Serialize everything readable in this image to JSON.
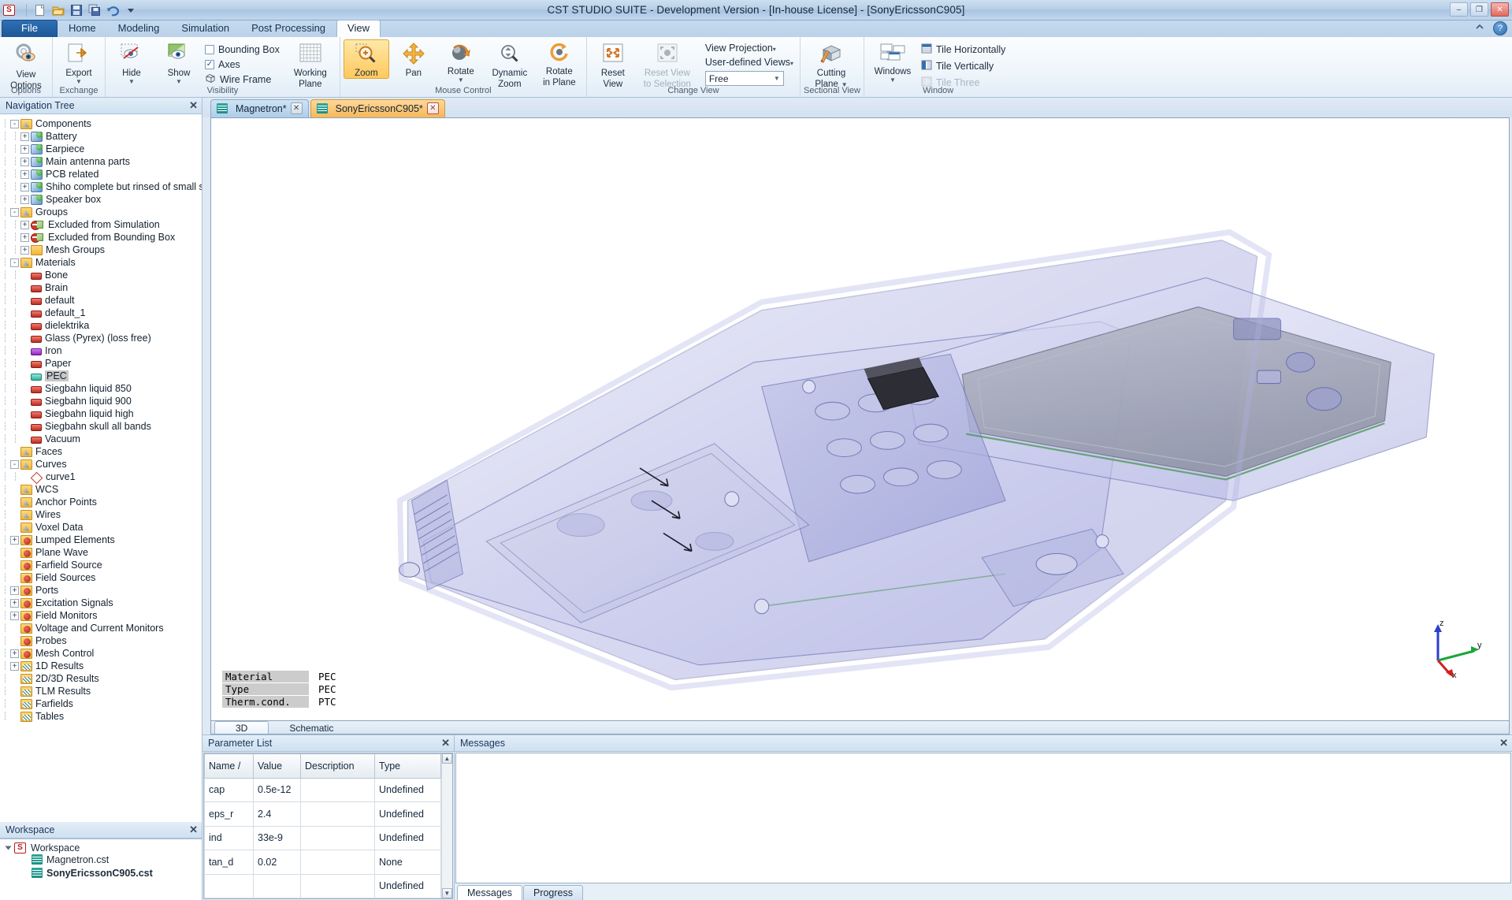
{
  "window": {
    "title": "CST STUDIO SUITE - Development Version - [In-house License] - [SonyEricssonC905]",
    "minimize": "–",
    "maximize": "❐",
    "close": "✕",
    "help": "?"
  },
  "quick_access": [
    "new-icon",
    "open-icon",
    "save-icon",
    "save-copy-icon",
    "undo-icon",
    "qat-more-icon"
  ],
  "ribbon_tabs": [
    {
      "label": "File",
      "kind": "file"
    },
    {
      "label": "Home",
      "kind": "normal"
    },
    {
      "label": "Modeling",
      "kind": "normal"
    },
    {
      "label": "Simulation",
      "kind": "normal"
    },
    {
      "label": "Post Processing",
      "kind": "normal"
    },
    {
      "label": "View",
      "kind": "active"
    }
  ],
  "ribbon": {
    "groups": [
      {
        "name": "Options",
        "label": "Options",
        "buttons": [
          {
            "label1": "View",
            "label2": "Options",
            "icon": "view-options-icon",
            "caret": false
          }
        ]
      },
      {
        "name": "Exchange",
        "label": "Exchange",
        "buttons": [
          {
            "label1": "Export",
            "label2": "",
            "icon": "export-icon",
            "caret": true
          }
        ]
      },
      {
        "name": "Visibility",
        "label": "Visibility",
        "buttons": [
          {
            "label1": "Hide",
            "label2": "",
            "icon": "hide-icon",
            "caret": true
          },
          {
            "label1": "Show",
            "label2": "",
            "icon": "show-icon",
            "caret": true
          }
        ],
        "checks": [
          {
            "label": "Bounding Box",
            "checked": false
          },
          {
            "label": "Axes",
            "checked": true
          },
          {
            "label": "Wire Frame",
            "checked": false,
            "icon": "wireframe-icon"
          }
        ],
        "extra": [
          {
            "label1": "Working",
            "label2": "Plane",
            "icon": "working-plane-icon",
            "caret": true
          }
        ]
      },
      {
        "name": "Mouse Control",
        "label": "Mouse Control",
        "buttons": [
          {
            "label1": "Zoom",
            "label2": "",
            "icon": "zoom-icon",
            "selected": true
          },
          {
            "label1": "Pan",
            "label2": "",
            "icon": "pan-icon"
          },
          {
            "label1": "Rotate",
            "label2": "",
            "icon": "rotate-icon",
            "caret": true
          },
          {
            "label1": "Dynamic",
            "label2": "Zoom",
            "icon": "dynamic-zoom-icon"
          },
          {
            "label1": "Rotate",
            "label2": "in Plane",
            "icon": "rotate-in-plane-icon"
          }
        ]
      },
      {
        "name": "Change View",
        "label": "Change View",
        "buttons": [
          {
            "label1": "Reset",
            "label2": "View",
            "icon": "reset-view-icon"
          },
          {
            "label1": "Reset View",
            "label2": "to Selection",
            "icon": "reset-view-selection-icon",
            "disabled": true
          }
        ],
        "menus": [
          "View Projection",
          "User-defined Views"
        ],
        "combo_value": "Free"
      },
      {
        "name": "Sectional View",
        "label": "Sectional View",
        "buttons": [
          {
            "label1": "Cutting",
            "label2": "Plane",
            "icon": "cutting-plane-icon",
            "caret": true
          }
        ]
      },
      {
        "name": "Window",
        "label": "Window",
        "buttons": [
          {
            "label1": "Windows",
            "label2": "",
            "icon": "windows-icon",
            "caret": true
          }
        ],
        "tiles": [
          {
            "label": "Tile Horizontally",
            "icon": "tile-horizontally-icon",
            "disabled": false
          },
          {
            "label": "Tile Vertically",
            "icon": "tile-vertically-icon",
            "disabled": false
          },
          {
            "label": "Tile Three",
            "icon": "tile-three-icon",
            "disabled": true
          }
        ]
      }
    ]
  },
  "navigation": {
    "title": "Navigation Tree",
    "close": "✕",
    "items": [
      {
        "label": "Components",
        "depth": 0,
        "expander": "-",
        "icon": "folder-warn"
      },
      {
        "label": "Battery",
        "depth": 1,
        "expander": "+",
        "icon": "component"
      },
      {
        "label": "Earpiece",
        "depth": 1,
        "expander": "+",
        "icon": "component"
      },
      {
        "label": "Main antenna parts",
        "depth": 1,
        "expander": "+",
        "icon": "component"
      },
      {
        "label": "PCB related",
        "depth": 1,
        "expander": "+",
        "icon": "component"
      },
      {
        "label": "Shiho complete but rinsed of small stuff",
        "depth": 1,
        "expander": "+",
        "icon": "component"
      },
      {
        "label": "Speaker box",
        "depth": 1,
        "expander": "+",
        "icon": "component"
      },
      {
        "label": "Groups",
        "depth": 0,
        "expander": "-",
        "icon": "folder-warn"
      },
      {
        "label": "Excluded from Simulation",
        "depth": 1,
        "expander": "+",
        "icon": "excluded"
      },
      {
        "label": "Excluded from Bounding Box",
        "depth": 1,
        "expander": "+",
        "icon": "excluded"
      },
      {
        "label": "Mesh Groups",
        "depth": 1,
        "expander": "+",
        "icon": "folder-plain"
      },
      {
        "label": "Materials",
        "depth": 0,
        "expander": "-",
        "icon": "folder-warn"
      },
      {
        "label": "Bone",
        "depth": 1,
        "expander": "",
        "icon": "material-red"
      },
      {
        "label": "Brain",
        "depth": 1,
        "expander": "",
        "icon": "material-red"
      },
      {
        "label": "default",
        "depth": 1,
        "expander": "",
        "icon": "material-red"
      },
      {
        "label": "default_1",
        "depth": 1,
        "expander": "",
        "icon": "material-red"
      },
      {
        "label": "dielektrika",
        "depth": 1,
        "expander": "",
        "icon": "material-red"
      },
      {
        "label": "Glass (Pyrex) (loss free)",
        "depth": 1,
        "expander": "",
        "icon": "material-red"
      },
      {
        "label": "Iron",
        "depth": 1,
        "expander": "",
        "icon": "material-purple"
      },
      {
        "label": "Paper",
        "depth": 1,
        "expander": "",
        "icon": "material-red"
      },
      {
        "label": "PEC",
        "depth": 1,
        "expander": "",
        "icon": "material-teal",
        "selected": true
      },
      {
        "label": "Siegbahn liquid 850",
        "depth": 1,
        "expander": "",
        "icon": "material-red"
      },
      {
        "label": "Siegbahn liquid 900",
        "depth": 1,
        "expander": "",
        "icon": "material-red"
      },
      {
        "label": "Siegbahn liquid high",
        "depth": 1,
        "expander": "",
        "icon": "material-red"
      },
      {
        "label": "Siegbahn skull all bands",
        "depth": 1,
        "expander": "",
        "icon": "material-red"
      },
      {
        "label": "Vacuum",
        "depth": 1,
        "expander": "",
        "icon": "material-red"
      },
      {
        "label": "Faces",
        "depth": 0,
        "expander": "",
        "icon": "folder-warn"
      },
      {
        "label": "Curves",
        "depth": 0,
        "expander": "-",
        "icon": "folder-warn"
      },
      {
        "label": "curve1",
        "depth": 1,
        "expander": "",
        "icon": "curve"
      },
      {
        "label": "WCS",
        "depth": 0,
        "expander": "",
        "icon": "folder-warn"
      },
      {
        "label": "Anchor Points",
        "depth": 0,
        "expander": "",
        "icon": "folder-warn"
      },
      {
        "label": "Wires",
        "depth": 0,
        "expander": "",
        "icon": "folder-warn"
      },
      {
        "label": "Voxel Data",
        "depth": 0,
        "expander": "",
        "icon": "folder-warn"
      },
      {
        "label": "Lumped Elements",
        "depth": 0,
        "expander": "+",
        "icon": "folder-gear"
      },
      {
        "label": "Plane Wave",
        "depth": 0,
        "expander": "",
        "icon": "folder-gear"
      },
      {
        "label": "Farfield Source",
        "depth": 0,
        "expander": "",
        "icon": "folder-gear"
      },
      {
        "label": "Field Sources",
        "depth": 0,
        "expander": "",
        "icon": "folder-gear"
      },
      {
        "label": "Ports",
        "depth": 0,
        "expander": "+",
        "icon": "folder-gear"
      },
      {
        "label": "Excitation Signals",
        "depth": 0,
        "expander": "+",
        "icon": "folder-gear"
      },
      {
        "label": "Field Monitors",
        "depth": 0,
        "expander": "+",
        "icon": "folder-gear"
      },
      {
        "label": "Voltage and Current Monitors",
        "depth": 0,
        "expander": "",
        "icon": "folder-gear"
      },
      {
        "label": "Probes",
        "depth": 0,
        "expander": "",
        "icon": "folder-gear"
      },
      {
        "label": "Mesh Control",
        "depth": 0,
        "expander": "+",
        "icon": "folder-gear"
      },
      {
        "label": "1D Results",
        "depth": 0,
        "expander": "+",
        "icon": "folder-results"
      },
      {
        "label": "2D/3D Results",
        "depth": 0,
        "expander": "",
        "icon": "folder-results"
      },
      {
        "label": "TLM Results",
        "depth": 0,
        "expander": "",
        "icon": "folder-results"
      },
      {
        "label": "Farfields",
        "depth": 0,
        "expander": "",
        "icon": "folder-results"
      },
      {
        "label": "Tables",
        "depth": 0,
        "expander": "",
        "icon": "folder-results"
      }
    ]
  },
  "workspace": {
    "title": "Workspace",
    "close": "✕",
    "root": "Workspace",
    "files": [
      {
        "name": "Magnetron.cst",
        "bold": false
      },
      {
        "name": "SonyEricssonC905.cst",
        "bold": true
      }
    ]
  },
  "document_tabs": [
    {
      "label": "Magnetron*",
      "active": false,
      "close": "✕"
    },
    {
      "label": "SonyEricssonC905*",
      "active": true,
      "close": "✕"
    }
  ],
  "viewport": {
    "material_box": [
      {
        "key": "Material",
        "value": "PEC"
      },
      {
        "key": "Type",
        "value": "PEC"
      },
      {
        "key": "Therm.cond.",
        "value": "PTC"
      }
    ],
    "axes": {
      "x": "x",
      "y": "y",
      "z": "z"
    },
    "tabs": [
      {
        "label": "3D",
        "active": true
      },
      {
        "label": "Schematic",
        "active": false
      }
    ]
  },
  "parameter_list": {
    "title": "Parameter List",
    "close": "✕",
    "columns": [
      "Name  /",
      "Value",
      "Description",
      "Type"
    ],
    "rows": [
      {
        "name": "cap",
        "value": "0.5e-12",
        "description": "",
        "type": "Undefined"
      },
      {
        "name": "eps_r",
        "value": "2.4",
        "description": "",
        "type": "Undefined"
      },
      {
        "name": "ind",
        "value": "33e-9",
        "description": "",
        "type": "Undefined"
      },
      {
        "name": "tan_d",
        "value": "0.02",
        "description": "",
        "type": "None"
      },
      {
        "name": "",
        "value": "",
        "description": "",
        "type": "Undefined"
      }
    ]
  },
  "messages": {
    "title": "Messages",
    "close": "✕",
    "body": "",
    "tabs": [
      {
        "label": "Messages",
        "active": true
      },
      {
        "label": "Progress",
        "active": false
      }
    ]
  },
  "colors": {
    "accent_orange": "#f6b858",
    "ribbon_blue": "#1d5796",
    "selection_gray": "#c8c8c8",
    "model_purple": "#9a9ad8"
  }
}
